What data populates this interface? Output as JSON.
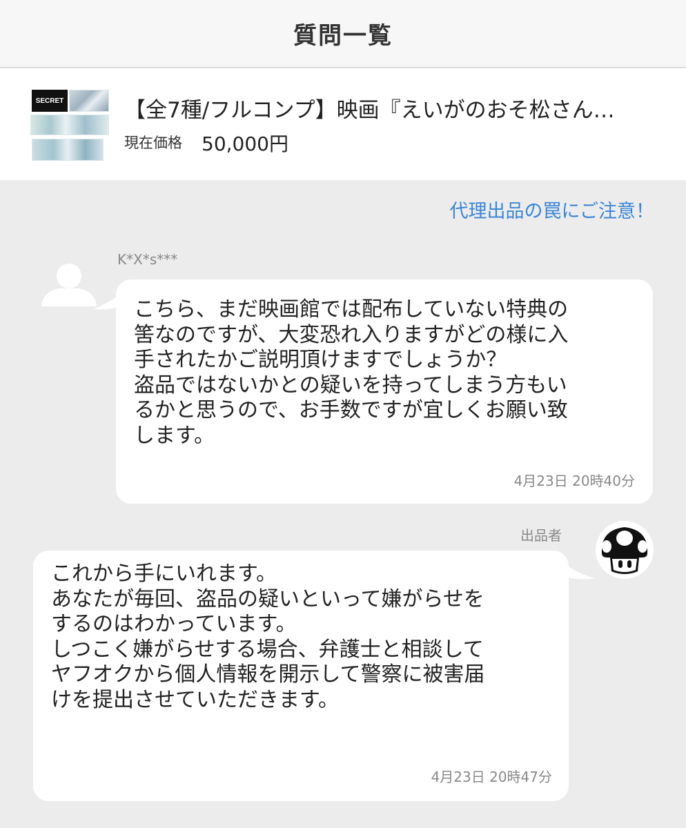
{
  "header": {
    "title": "質問一覧"
  },
  "item": {
    "thumbnail_badge": "SECRET",
    "title": "【全7種/フルコンプ】映画『えいがのおそ松さん…",
    "price_label": "現在価格",
    "price": "50,000円"
  },
  "warning_link": "代理出品の罠にご注意！",
  "messages": [
    {
      "author": "K*X*s***",
      "text": "こちら、まだ映画館では配布していない特典の\n筈なのですが、大変恐れ入りますがどの様に入\n手されたかご説明頂けますでしょうか？\n盗品ではないかとの疑いを持ってしまう方もい\nるかと思うので、お手数ですが宜しくお願い致\nします。",
      "timestamp": "4月23日 20時40分"
    },
    {
      "author": "出品者",
      "text": "これから手にいれます。\nあなたが毎回、盗品の疑いといって嫌がらせを\nするのはわかっています。\nしつこく嫌がらせする場合、弁護士と相談して\nヤフオクから個人情報を開示して警察に被害届\nけを提出させていただきます。",
      "timestamp": "4月23日 20時47分"
    }
  ],
  "colors": {
    "link": "#3a86d6",
    "background": "#ececec",
    "bubble": "#ffffff"
  },
  "icons": {
    "default_avatar": "person-silhouette-icon",
    "seller_avatar": "mushroom-icon"
  }
}
